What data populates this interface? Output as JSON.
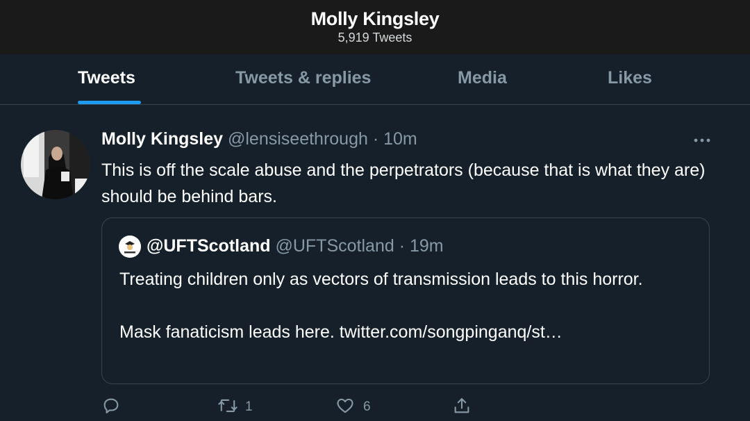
{
  "header": {
    "title": "Molly Kingsley",
    "subtitle": "5,919 Tweets"
  },
  "tabs": [
    {
      "label": "Tweets",
      "active": true
    },
    {
      "label": "Tweets & replies",
      "active": false
    },
    {
      "label": "Media",
      "active": false
    },
    {
      "label": "Likes",
      "active": false
    }
  ],
  "tweet": {
    "display_name": "Molly Kingsley",
    "meta": "@lensiseethrough · 10m",
    "text": "This is off the scale abuse and the perpetrators (because that is what they are) should be behind bars.",
    "quote": {
      "display_name": "@UFTScotland",
      "meta": "@UFTScotland · 19m",
      "text_line1": "Treating children only as vectors of transmission leads to this horror.",
      "text_line2": "Mask fanaticism leads here. twitter.com/songpinganq/st…"
    },
    "actions": {
      "reply_count": "",
      "retweet_count": "1",
      "like_count": "6"
    }
  },
  "icons": {
    "more": "more-horizontal-icon",
    "reply": "reply-icon",
    "retweet": "retweet-icon",
    "like": "heart-icon",
    "share": "share-icon"
  },
  "colors": {
    "background": "#15202b",
    "header_background": "#1a1a1a",
    "accent": "#1d9bf0",
    "secondary_text": "#8899a6",
    "border": "#38444d"
  }
}
